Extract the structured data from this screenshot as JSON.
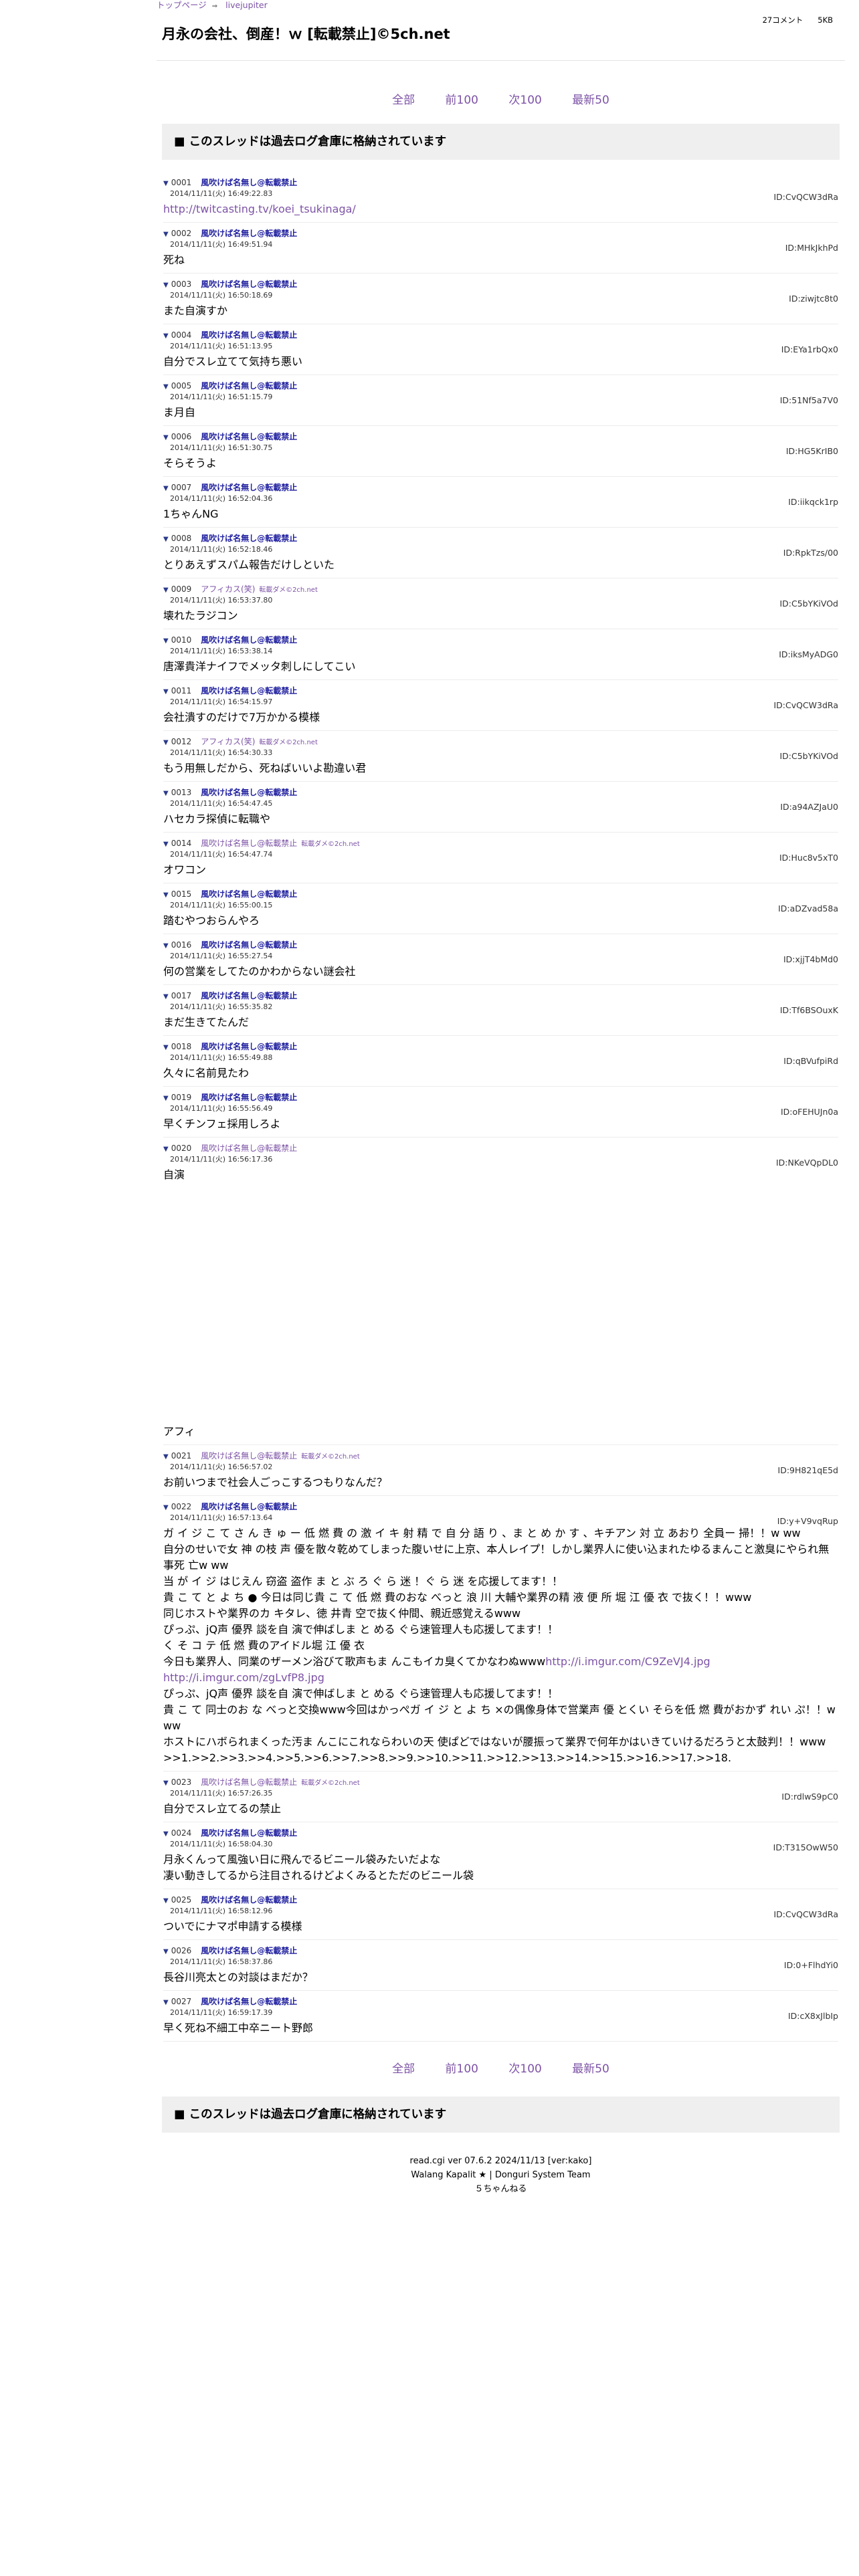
{
  "breadcrumb": {
    "home": "トップページ",
    "sep": "⇒",
    "board": "livejupiter"
  },
  "thread": {
    "title": "月永の会社、倒産！ｗ [転載禁止]©5ch.net",
    "comments": "27コメント",
    "size": "5KB"
  },
  "nav": {
    "all": "全部",
    "prev": "前100",
    "next": "次100",
    "latest": "最新50"
  },
  "archive_notice": "■ このスレッドは過去ログ倉庫に格納されています",
  "posts": [
    {
      "num": "0001",
      "name": "風吹けば名無し@転載禁止",
      "alt": false,
      "tag": "",
      "date": "2014/11/11(火) 16:49:22.83",
      "id": "ID:CvQCW3dRa",
      "body": [
        {
          "t": "http://twitcasting.tv/koei_tsukinaga/",
          "link": true
        }
      ]
    },
    {
      "num": "0002",
      "name": "風吹けば名無し@転載禁止",
      "alt": false,
      "tag": "",
      "date": "2014/11/11(火) 16:49:51.94",
      "id": "ID:MHkJkhPd",
      "body": [
        {
          "t": "死ね"
        }
      ]
    },
    {
      "num": "0003",
      "name": "風吹けば名無し@転載禁止",
      "alt": false,
      "tag": "",
      "date": "2014/11/11(火) 16:50:18.69",
      "id": "ID:ziwjtc8t0",
      "body": [
        {
          "t": "また自演すか"
        }
      ]
    },
    {
      "num": "0004",
      "name": "風吹けば名無し@転載禁止",
      "alt": false,
      "tag": "",
      "date": "2014/11/11(火) 16:51:13.95",
      "id": "ID:EYa1rbQx0",
      "body": [
        {
          "t": "自分でスレ立てて気持ち悪い"
        }
      ]
    },
    {
      "num": "0005",
      "name": "風吹けば名無し@転載禁止",
      "alt": false,
      "tag": "",
      "date": "2014/11/11(火) 16:51:15.79",
      "id": "ID:51Nf5a7V0",
      "body": [
        {
          "t": "ま月自"
        }
      ]
    },
    {
      "num": "0006",
      "name": "風吹けば名無し@転載禁止",
      "alt": false,
      "tag": "",
      "date": "2014/11/11(火) 16:51:30.75",
      "id": "ID:HG5KrIB0",
      "body": [
        {
          "t": "そらそうよ"
        }
      ]
    },
    {
      "num": "0007",
      "name": "風吹けば名無し@転載禁止",
      "alt": false,
      "tag": "",
      "date": "2014/11/11(火) 16:52:04.36",
      "id": "ID:iikqck1rp",
      "body": [
        {
          "t": "1ちゃんNG"
        }
      ]
    },
    {
      "num": "0008",
      "name": "風吹けば名無し@転載禁止",
      "alt": false,
      "tag": "",
      "date": "2014/11/11(火) 16:52:18.46",
      "id": "ID:RpkTzs/00",
      "body": [
        {
          "t": "とりあえずスパム報告だけしといた"
        }
      ]
    },
    {
      "num": "0009",
      "name": "アフィカス(笑)",
      "alt": true,
      "tag": "転載ダメ©2ch.net",
      "date": "2014/11/11(火) 16:53:37.80",
      "id": "ID:C5bYKiVOd",
      "body": [
        {
          "t": "壊れたラジコン"
        }
      ]
    },
    {
      "num": "0010",
      "name": "風吹けば名無し@転載禁止",
      "alt": false,
      "tag": "",
      "date": "2014/11/11(火) 16:53:38.14",
      "id": "ID:iksMyADG0",
      "body": [
        {
          "t": "唐澤貴洋ナイフでメッタ刺しにしてこい"
        }
      ]
    },
    {
      "num": "0011",
      "name": "風吹けば名無し@転載禁止",
      "alt": false,
      "tag": "",
      "date": "2014/11/11(火) 16:54:15.97",
      "id": "ID:CvQCW3dRa",
      "body": [
        {
          "t": "会社潰すのだけで7万かかる模様"
        }
      ]
    },
    {
      "num": "0012",
      "name": "アフィカス(笑)",
      "alt": true,
      "tag": "転載ダメ©2ch.net",
      "date": "2014/11/11(火) 16:54:30.33",
      "id": "ID:C5bYKiVOd",
      "body": [
        {
          "t": "もう用無しだから、死ねばいいよ勘違い君"
        }
      ]
    },
    {
      "num": "0013",
      "name": "風吹けば名無し@転載禁止",
      "alt": false,
      "tag": "",
      "date": "2014/11/11(火) 16:54:47.45",
      "id": "ID:a94AZJaU0",
      "body": [
        {
          "t": "ハセカラ探偵に転職や"
        }
      ]
    },
    {
      "num": "0014",
      "name": "風吹けば名無し@転載禁止",
      "alt": true,
      "tag": "転載ダメ©2ch.net",
      "date": "2014/11/11(火) 16:54:47.74",
      "id": "ID:Huc8v5xT0",
      "body": [
        {
          "t": "オワコン"
        }
      ]
    },
    {
      "num": "0015",
      "name": "風吹けば名無し@転載禁止",
      "alt": false,
      "tag": "",
      "date": "2014/11/11(火) 16:55:00.15",
      "id": "ID:aDZvad58a",
      "body": [
        {
          "t": "踏むやつおらんやろ"
        }
      ]
    },
    {
      "num": "0016",
      "name": "風吹けば名無し@転載禁止",
      "alt": false,
      "tag": "",
      "date": "2014/11/11(火) 16:55:27.54",
      "id": "ID:xjjT4bMd0",
      "body": [
        {
          "t": "何の営業をしてたのかわからない謎会社"
        }
      ]
    },
    {
      "num": "0017",
      "name": "風吹けば名無し@転載禁止",
      "alt": false,
      "tag": "",
      "date": "2014/11/11(火) 16:55:35.82",
      "id": "ID:Tf6BSOuxK",
      "body": [
        {
          "t": "まだ生きてたんだ"
        }
      ]
    },
    {
      "num": "0018",
      "name": "風吹けば名無し@転載禁止",
      "alt": false,
      "tag": "",
      "date": "2014/11/11(火) 16:55:49.88",
      "id": "ID:qBVufpiRd",
      "body": [
        {
          "t": "久々に名前見たわ"
        }
      ]
    },
    {
      "num": "0019",
      "name": "風吹けば名無し@転載禁止",
      "alt": false,
      "tag": "",
      "date": "2014/11/11(火) 16:55:56.49",
      "id": "ID:oFEHUJn0a",
      "body": [
        {
          "t": "早くチンフェ採用しろよ"
        }
      ]
    },
    {
      "num": "0020",
      "name": "風吹けば名無し@転載禁止",
      "alt": true,
      "tag": "",
      "date": "2014/11/11(火) 16:56:17.36",
      "id": "ID:NKeVQpDL0",
      "body": [
        {
          "t": "自演\n\n\n\n\n\n\n\n\n\n\n\n\n\n\n\nアフィ"
        }
      ]
    },
    {
      "num": "0021",
      "name": "風吹けば名無し@転載禁止",
      "alt": true,
      "tag": "転載ダメ©2ch.net",
      "date": "2014/11/11(火) 16:56:57.02",
      "id": "ID:9H821qE5d",
      "body": [
        {
          "t": "お前いつまで社会人ごっこするつもりなんだ？"
        }
      ]
    },
    {
      "num": "0022",
      "name": "風吹けば名無し@転載禁止",
      "alt": false,
      "tag": "",
      "date": "2014/11/11(火) 16:57:13.64",
      "id": "ID:y+V9vqRup",
      "body": [
        {
          "t": "ガ イ ジ こ て さ ん き ゅ ー 低 燃 費 の 激 イ キ 射 精 で 自 分 語 り 、ま と め か す 、キチアン 対 立 あおり 全員ー 掃！！w ww\n自分のせいで女 神 の枝 声 優を散々乾めてしまった腹いせに上京、本人レイプ！しかし業界人に使い込まれたゆるまんこと激臭にやられ無事死 亡w ww\n当 が イ ジ はじえん 窃盗 盗作 ま と ぶ ろ ぐ ら 迷 ！ぐ ら 迷 を応援してます！！\n貴 こ て と よ ち ● 今日は同じ貴 こ て 低 燃 費のおな べっと 浪 川 大輔や業界の精 液 便 所 堀 江 優 衣 で抜く！！www\n同じホストや業界のカ キタレ、徳 井青 空で抜く仲間、親近感覚えるwww\nぴっぷ、jQ声 優界 談を自 演で伸ばしま と める ぐら速管理人も応援してます！！\nく そ コ テ 低 燃 費のアイドル堀 江 優 衣\n今日も業界人、同業のザーメン浴びて歌声もま んこもイカ臭くてかなわぬwww"
        },
        {
          "t": "http://i.imgur.com/C9ZeVJ4.jpg\nhttp://i.imgur.com/zgLvfP8.jpg",
          "link": true
        },
        {
          "t": "\nぴっぷ、jQ声 優界 談を自 演で伸ばしま と める ぐら速管理人も応援してます！！\n貴 こ て 同士のお な べっと交換www今回はかっぺガ イ ジ と よ ち ×の偶像身体で営業声 優 とくい そらを低 燃 費がおかず れい ぷ！！www\nホストにハボられまくった汚ま んこにこれならわいの天 使ぱどではないが腰振って業界で何年かはいきていけるだろうと太鼓判！！www\n>>1.>>2.>>3.>>4.>>5.>>6.>>7.>>8.>>9.>>10.>>11.>>12.>>13.>>14.>>15.>>16.>>17.>>18."
        }
      ]
    },
    {
      "num": "0023",
      "name": "風吹けば名無し@転載禁止",
      "alt": true,
      "tag": "転載ダメ©2ch.net",
      "date": "2014/11/11(火) 16:57:26.35",
      "id": "ID:rdlwS9pC0",
      "body": [
        {
          "t": "自分でスレ立てるの禁止"
        }
      ]
    },
    {
      "num": "0024",
      "name": "風吹けば名無し@転載禁止",
      "alt": false,
      "tag": "",
      "date": "2014/11/11(火) 16:58:04.30",
      "id": "ID:T315OwW50",
      "body": [
        {
          "t": "月永くんって風強い日に飛んでるビニール袋みたいだよな\n凄い動きしてるから注目されるけどよくみるとただのビニール袋"
        }
      ]
    },
    {
      "num": "0025",
      "name": "風吹けば名無し@転載禁止",
      "alt": false,
      "tag": "",
      "date": "2014/11/11(火) 16:58:12.96",
      "id": "ID:CvQCW3dRa",
      "body": [
        {
          "t": "ついでにナマポ申請する模様"
        }
      ]
    },
    {
      "num": "0026",
      "name": "風吹けば名無し@転載禁止",
      "alt": false,
      "tag": "",
      "date": "2014/11/11(火) 16:58:37.86",
      "id": "ID:0+FlhdYi0",
      "body": [
        {
          "t": "長谷川亮太との対談はまだか？"
        }
      ]
    },
    {
      "num": "0027",
      "name": "風吹けば名無し@転載禁止",
      "alt": false,
      "tag": "",
      "date": "2014/11/11(火) 16:59:17.39",
      "id": "ID:cX8xJlbIp",
      "body": [
        {
          "t": "早く死ね不細工中卒ニート野郎"
        }
      ]
    }
  ],
  "footer": {
    "line1": "read.cgi ver 07.6.2 2024/11/13 [ver:kako]",
    "line2": "Walang Kapalit ★ | Donguri System Team",
    "line3": "５ちゃんねる"
  },
  "colors": {
    "link": "#7d53a6",
    "name": "#2020a0",
    "archive_bg": "#efefef"
  }
}
